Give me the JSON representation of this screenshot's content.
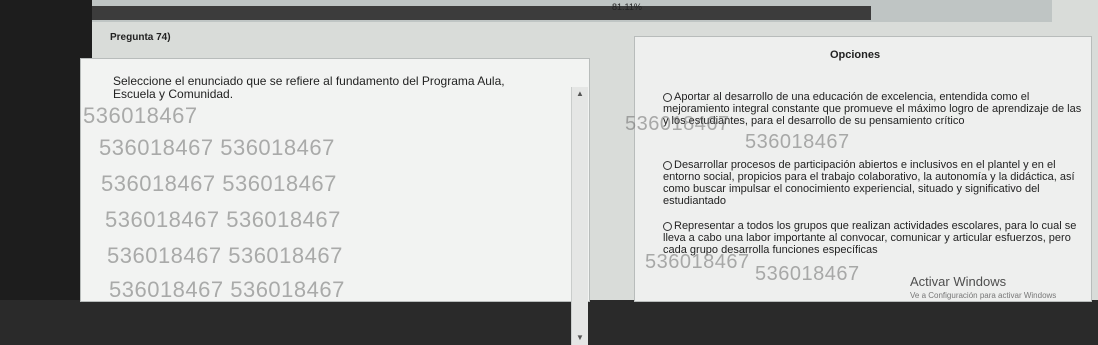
{
  "progress": {
    "label": "81.11%",
    "value_percent": 81.11
  },
  "question": {
    "label": "Pregunta 74)",
    "text": "Seleccione el enunciado que se refiere al fundamento del Programa Aula, Escuela y Comunidad."
  },
  "watermark": {
    "text": "536018467",
    "text_pair": "536018467 536018467"
  },
  "options": {
    "title": "Opciones",
    "items": [
      {
        "text": "Aportar al desarrollo de una educación de excelencia, entendida como el mejoramiento integral constante que promueve el máximo logro de aprendizaje de las y los estudiantes, para el desarrollo de su pensamiento crítico"
      },
      {
        "text": "Desarrollar procesos de participación abiertos e inclusivos en el plantel y en el entorno social, propicios para el trabajo colaborativo, la autonomía y la didáctica, así como buscar impulsar el conocimiento experiencial, situado y significativo del estudiantado"
      },
      {
        "text": "Representar a todos los grupos que realizan actividades escolares, para lo cual se lleva a cabo una labor importante al convocar, comunicar y articular esfuerzos, pero cada grupo desarrolla funciones específicas"
      }
    ]
  },
  "windows_notice": {
    "title": "Activar Windows",
    "subtitle": "Ve a Configuración para activar Windows"
  }
}
